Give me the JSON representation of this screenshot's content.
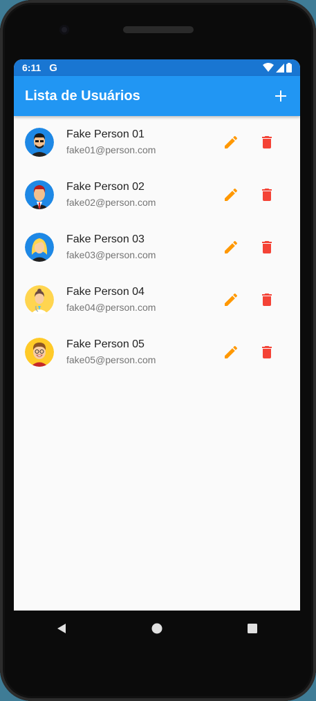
{
  "status": {
    "time": "6:11",
    "g": "G"
  },
  "appbar": {
    "title": "Lista de Usuários",
    "add_icon": "add-icon"
  },
  "colors": {
    "appbar": "#2196f3",
    "statusbar": "#1976d2",
    "edit": "#ff9800",
    "delete": "#f44336"
  },
  "users": [
    {
      "name": "Fake Person 01",
      "email": "fake01@person.com"
    },
    {
      "name": "Fake Person 02",
      "email": "fake02@person.com"
    },
    {
      "name": "Fake Person 03",
      "email": "fake03@person.com"
    },
    {
      "name": "Fake Person 04",
      "email": "fake04@person.com"
    },
    {
      "name": "Fake Person 05",
      "email": "fake05@person.com"
    }
  ]
}
